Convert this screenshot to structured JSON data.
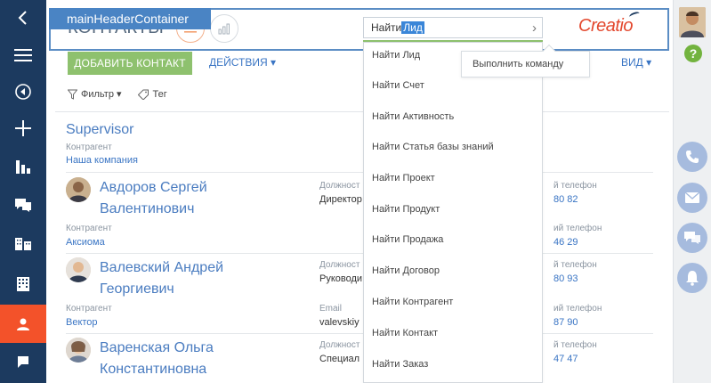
{
  "nav": {
    "items": [
      {
        "name": "back-icon"
      },
      {
        "name": "menu-icon"
      },
      {
        "name": "play-icon"
      },
      {
        "name": "plus-icon"
      },
      {
        "name": "analytics-icon"
      },
      {
        "name": "feed-icon"
      },
      {
        "name": "accounts-icon"
      },
      {
        "name": "companies-icon"
      },
      {
        "name": "contacts-icon",
        "active": true
      },
      {
        "name": "flag-icon"
      }
    ],
    "accent": "#f3522a",
    "background": "#1c3a5f"
  },
  "header": {
    "page_title": "КОНТАКТЫ",
    "container_label": "mainHeaderContainer",
    "command_input": {
      "typed": "Найти ",
      "selected": "Лид",
      "go_symbol": "›"
    },
    "logo": "Creatio"
  },
  "toolbar": {
    "add_label": "ДОБАВИТЬ КОНТАКТ",
    "actions_label": "ДЕЙСТВИЯ ▾",
    "view_label": "ВИД ▾",
    "filter_label": "Фильтр ▾",
    "tag_label": "Тег"
  },
  "dropdown": {
    "items": [
      "Найти Лид",
      "Найти Счет",
      "Найти Активность",
      "Найти Статья базы знаний",
      "Найти Проект",
      "Найти Продукт",
      "Найти Продажа",
      "Найти Договор",
      "Найти Контрагент",
      "Найти Контакт",
      "Найти Заказ"
    ],
    "run_command": "Выполнить команду"
  },
  "records": {
    "supervisor": {
      "name": "Supervisor",
      "account_label": "Контрагент",
      "account": "Наша компания"
    },
    "r1": {
      "name1": "Авдоров Сергей",
      "name2": "Валентинович",
      "col_label": "Должност",
      "col_val": "Директор",
      "phone_label": "й телефон",
      "phone_val": "80 82",
      "account_label": "Контрагент",
      "account": "Аксиома",
      "phone2_label": "ий телефон",
      "phone2_val": "46 29"
    },
    "r2": {
      "name1": "Валевский Андрей",
      "name2": "Георгиевич",
      "col_label": "Должност",
      "col_val": "Руководи",
      "phone_label": "й телефон",
      "phone_val": "80 93",
      "account_label": "Контрагент",
      "account": "Вектор",
      "col2_label": "Email",
      "col2_val": "valevskiy",
      "phone2_label": "ий телефон",
      "phone2_val": "87 90"
    },
    "r3": {
      "name1": "Варенская Ольга",
      "name2": "Константиновна",
      "col_label": "Должност",
      "col_val": "Специал",
      "phone_label": "й телефон",
      "phone_val": "47 47"
    }
  },
  "right_panel": {
    "help_symbol": "?",
    "buttons": [
      "phone-icon",
      "email-icon",
      "chat-icon",
      "bell-icon"
    ]
  }
}
